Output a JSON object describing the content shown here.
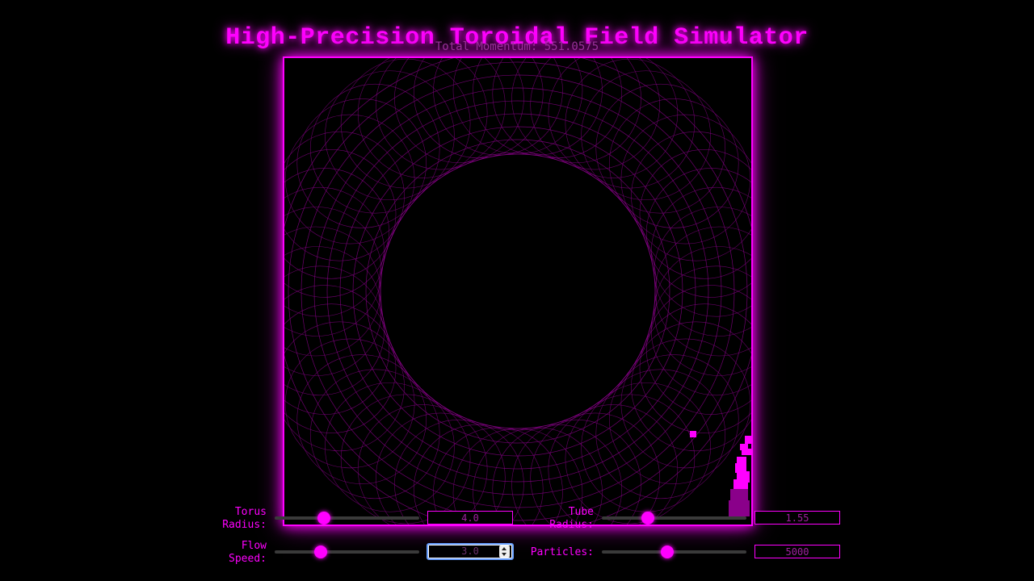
{
  "header": {
    "title": "High-Precision Toroidal Field Simulator",
    "momentum_label": "Total Momentum: 551.0575"
  },
  "theme": {
    "accent": "#ff00ff",
    "grid_line": "#8a008a",
    "background": "#000000"
  },
  "controls": {
    "torus_radius": {
      "label": "Torus Radius:",
      "value": "4.0",
      "fraction": 0.34
    },
    "tube_radius": {
      "label": "Tube Radius:",
      "value": "1.55",
      "fraction": 0.32
    },
    "flow_speed": {
      "label": "Flow Speed:",
      "value": "3.0",
      "fraction": 0.32
    },
    "particles": {
      "label": "Particles:",
      "value": "5000",
      "fraction": 0.45
    }
  }
}
